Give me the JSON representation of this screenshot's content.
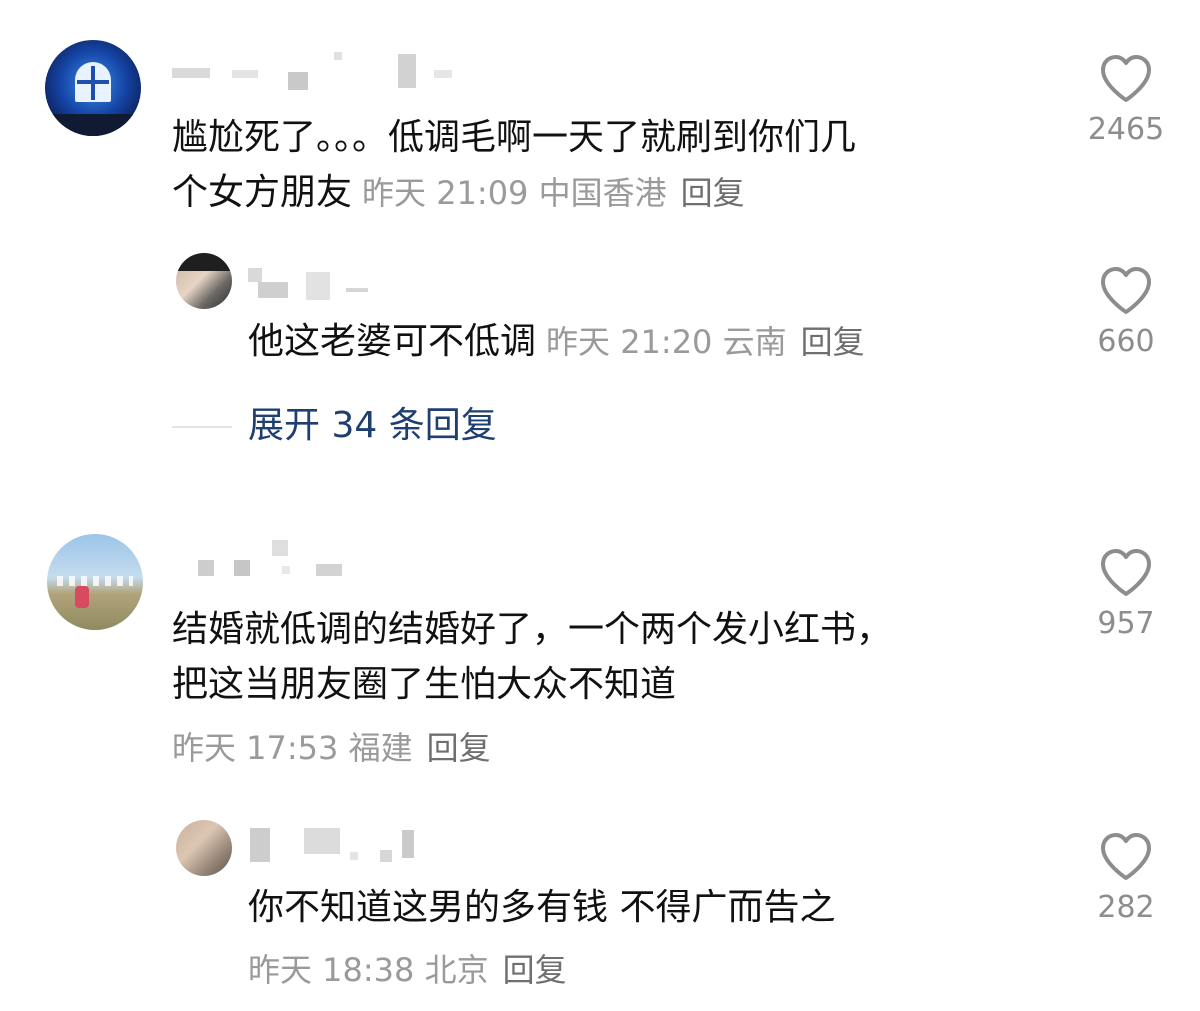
{
  "comments": [
    {
      "text": "尴尬死了。。。低调毛啊一天了就刷到你们几个女方朋友",
      "text_line1": "尴尬死了。。。低调毛啊一天了就刷到你们几",
      "text_line2": "个女方朋友",
      "meta": "昨天 21:09 中国香港",
      "reply_label": "回复",
      "likes": "2465",
      "replies": [
        {
          "text": "他这老婆可不低调",
          "meta": "昨天 21:20 云南",
          "reply_label": "回复",
          "likes": "660"
        }
      ],
      "expand_label": "展开 34 条回复"
    },
    {
      "text": "结婚就低调的结婚好了，一个两个发小红书，把这当朋友圈了生怕大众不知道",
      "text_line1": "结婚就低调的结婚好了，一个两个发小红书，",
      "text_line2": "把这当朋友圈了生怕大众不知道",
      "meta": "昨天 17:53 福建",
      "reply_label": "回复",
      "likes": "957",
      "replies": [
        {
          "text": "你不知道这男的多有钱 不得广而告之",
          "meta": "昨天 18:38 北京",
          "reply_label": "回复",
          "likes": "282"
        }
      ]
    }
  ],
  "icons": {
    "like": "heart-outline-icon"
  },
  "colors": {
    "text": "#111111",
    "meta": "#9a9a9a",
    "expand_link": "#1e3f70",
    "like_count": "#8d8d8d"
  }
}
